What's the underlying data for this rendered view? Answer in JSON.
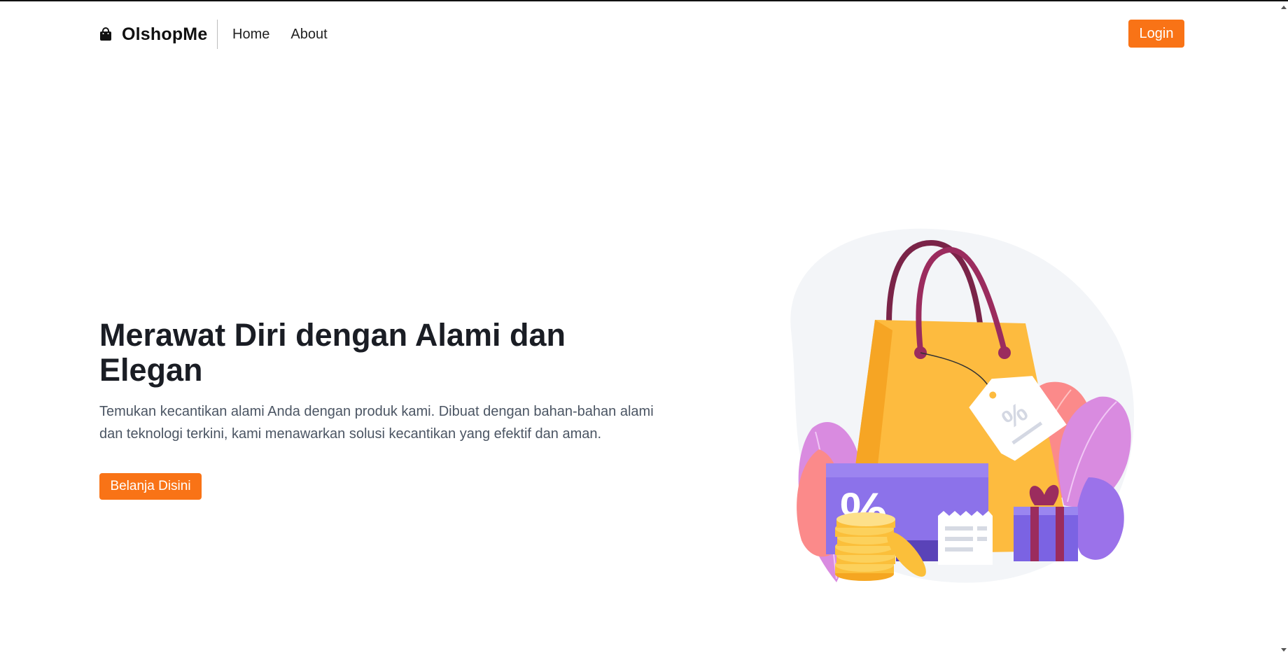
{
  "navbar": {
    "brand": "OlshopMe",
    "brand_icon": "shopping-bag-icon",
    "links": [
      "Home",
      "About"
    ],
    "login_label": "Login"
  },
  "hero": {
    "title": "Merawat Diri dengan Alami dan Elegan",
    "description": "Temukan kecantikan alami Anda dengan produk kami. Dibuat dengan bahan-bahan alami dan teknologi terkini, kami menawarkan solusi kecantikan yang efektif dan aman.",
    "cta_label": "Belanja Disini",
    "illustration": "shopping-bag-discount-illustration"
  },
  "colors": {
    "accent": "#f97316",
    "heading": "#1a1d24",
    "body_text": "#4b5563"
  }
}
